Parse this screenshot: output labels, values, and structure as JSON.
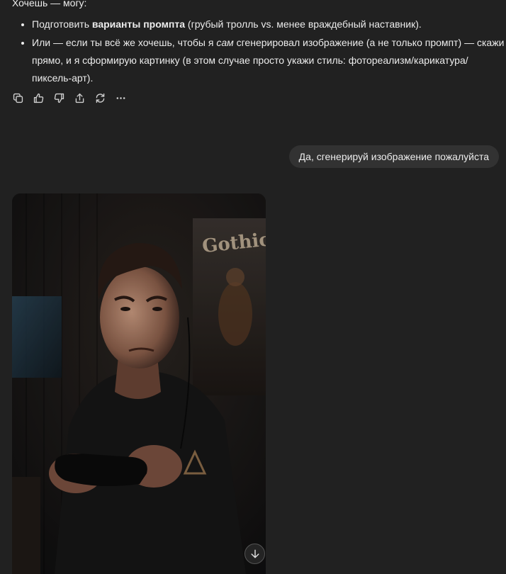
{
  "assistant": {
    "intro": "Хочешь — могу:",
    "bullets": [
      {
        "before": "Подготовить ",
        "bold": "варианты промпта",
        "after": " (грубый тролль vs. менее враждебный наставник)."
      },
      {
        "before": "Или — если ты всё же хочешь, чтобы я ",
        "italic": "сам",
        "after": " сгенерировал изображение (а не только промпт) — скажи прямо, и я сформирую картинку (в этом случае просто укажи стиль: фотореализм/карикатура/пиксель-арт)."
      }
    ],
    "actions": [
      {
        "name": "copy-icon",
        "label": "copy"
      },
      {
        "name": "thumbs-up-icon",
        "label": "good response"
      },
      {
        "name": "thumbs-down-icon",
        "label": "bad response"
      },
      {
        "name": "share-icon",
        "label": "share"
      },
      {
        "name": "regenerate-icon",
        "label": "regenerate"
      },
      {
        "name": "more-icon",
        "label": "more"
      }
    ]
  },
  "user_message": "Да, сгенерируй изображение пожалуйста",
  "generated_image": {
    "poster_text": "Gothic",
    "download_icon": "arrow-down-icon"
  },
  "colors": {
    "background": "#212121",
    "text": "#ececec",
    "user_bubble": "#323232"
  }
}
